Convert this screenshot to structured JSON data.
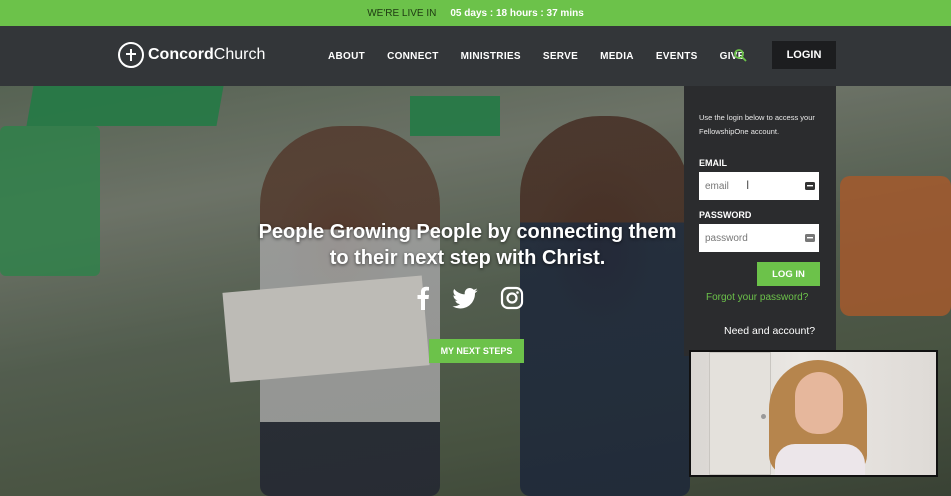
{
  "live_bar": {
    "prefix": "WE'RE LIVE IN",
    "countdown": "05 days : 18 hours : 37 mins"
  },
  "header": {
    "logo_bold": "Concord",
    "logo_regular": "Church",
    "nav": [
      "ABOUT",
      "CONNECT",
      "MINISTRIES",
      "SERVE",
      "MEDIA",
      "EVENTS",
      "GIVE"
    ],
    "login_label": "LOGIN"
  },
  "hero": {
    "headline_line1": "People Growing People by connecting them",
    "headline_line2": "to their next step with Christ.",
    "cta_label": "MY NEXT STEPS",
    "social_icons": [
      "facebook-icon",
      "twitter-icon",
      "instagram-icon"
    ]
  },
  "login_panel": {
    "info": "Use the login below to access your FellowshipOne account.",
    "email_label": "EMAIL",
    "email_placeholder": "email",
    "password_label": "PASSWORD",
    "password_placeholder": "password",
    "submit_label": "LOG IN",
    "forgot_label": "Forgot your password?",
    "need_account_label": "Need and account?"
  },
  "colors": {
    "accent_green": "#6cc24a",
    "header_dark": "#333639",
    "panel_dark": "#2b2c2e"
  }
}
